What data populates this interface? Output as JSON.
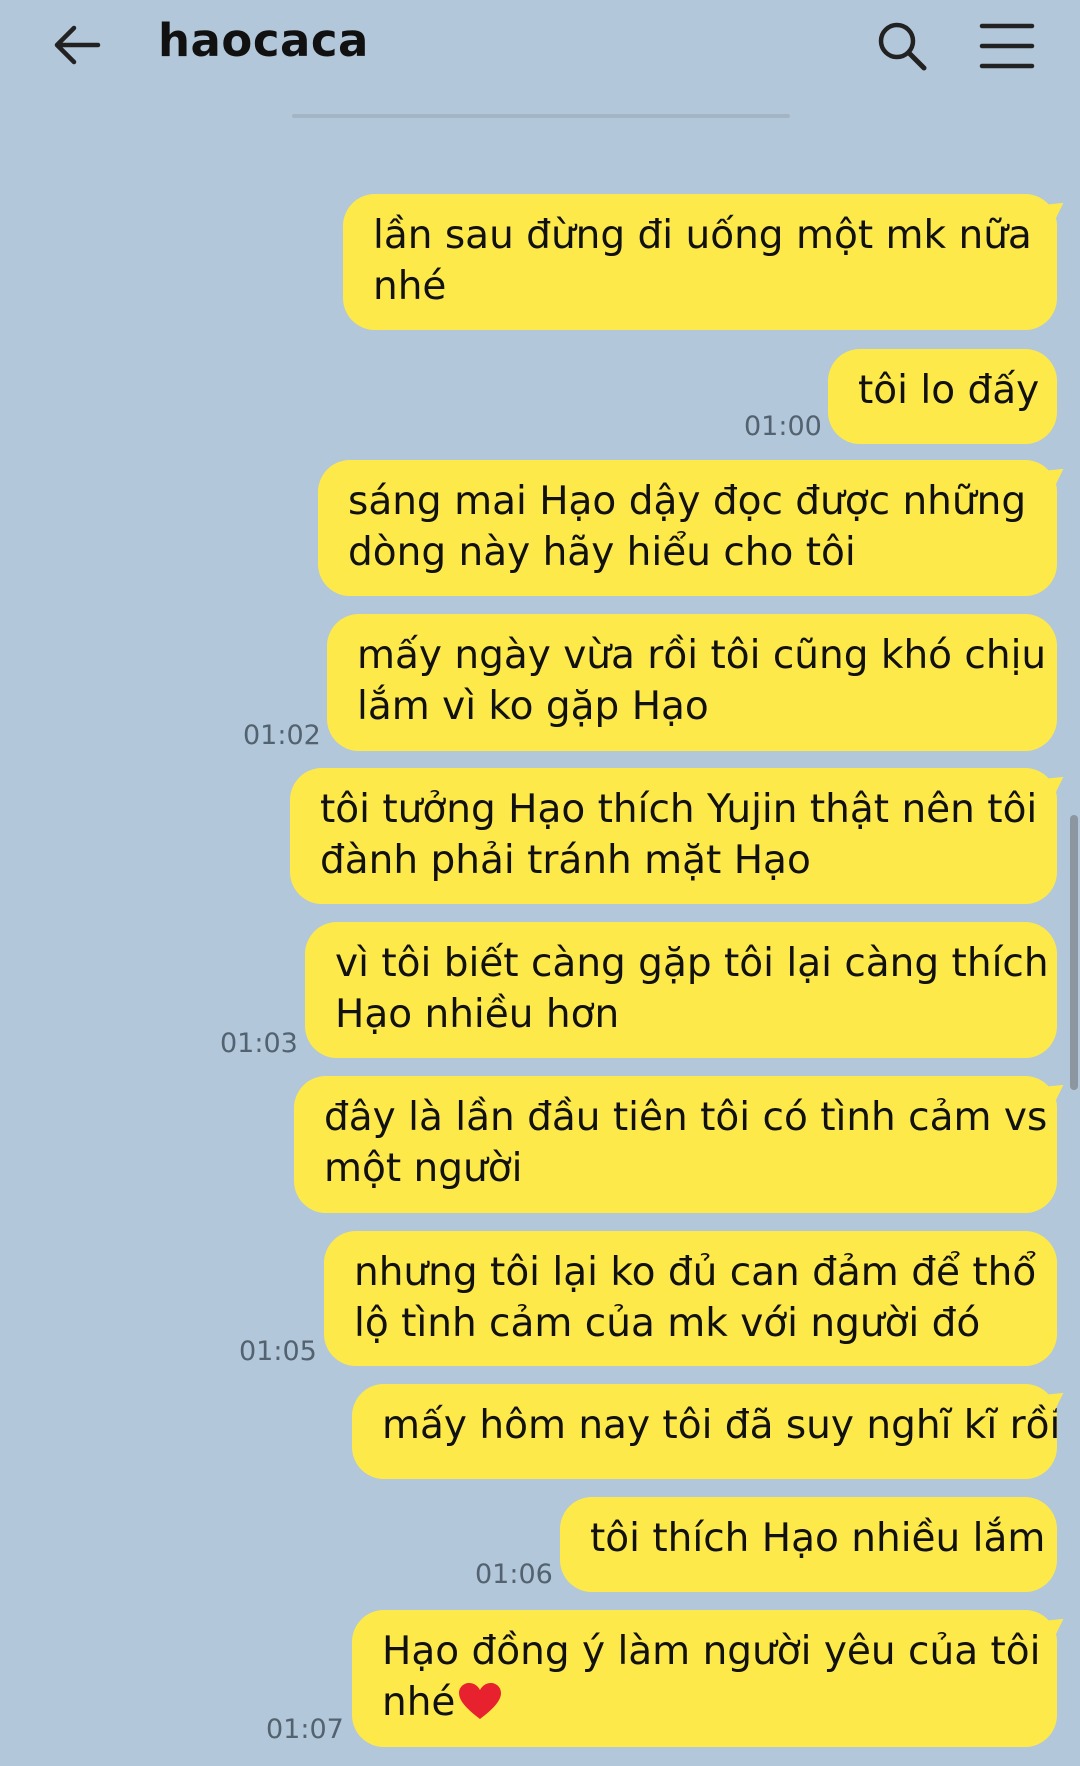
{
  "header": {
    "title": "haocaca"
  },
  "messages": [
    {
      "line1": "lần sau đừng đi uống một mk nữa",
      "line2": "nhé"
    },
    {
      "line1": "tôi lo đấy",
      "line2": ""
    },
    {
      "line1": "sáng mai Hạo dậy đọc được những",
      "line2": "dòng này hãy hiểu cho tôi"
    },
    {
      "line1": "mấy ngày vừa rồi tôi cũng khó chịu",
      "line2": "lắm vì ko gặp Hạo"
    },
    {
      "line1": "tôi tưởng Hạo thích Yujin thật nên tôi",
      "line2": "đành phải tránh mặt Hạo"
    },
    {
      "line1": "vì tôi biết càng gặp tôi lại càng thích",
      "line2": "Hạo nhiều hơn"
    },
    {
      "line1": "đây là lần đầu tiên tôi có tình cảm vs",
      "line2": "một người"
    },
    {
      "line1": "nhưng tôi lại ko đủ can đảm để thổ",
      "line2": "lộ tình cảm của mk với người đó"
    },
    {
      "line1": "mấy hôm nay tôi đã suy nghĩ kĩ rồi",
      "line2": ""
    },
    {
      "line1": "tôi thích Hạo nhiều lắm",
      "line2": ""
    },
    {
      "line1": "Hạo đồng ý làm người yêu của tôi",
      "line2": "nhé"
    }
  ],
  "timestamps": [
    "01:00",
    "01:02",
    "01:03",
    "01:05",
    "01:06",
    "01:07"
  ],
  "colors": {
    "background": "#b2c7d9",
    "bubble": "#fee94b",
    "timestamp": "#526270"
  },
  "icons": [
    "back-arrow-icon",
    "search-icon",
    "menu-icon",
    "heart-emoji-icon"
  ]
}
